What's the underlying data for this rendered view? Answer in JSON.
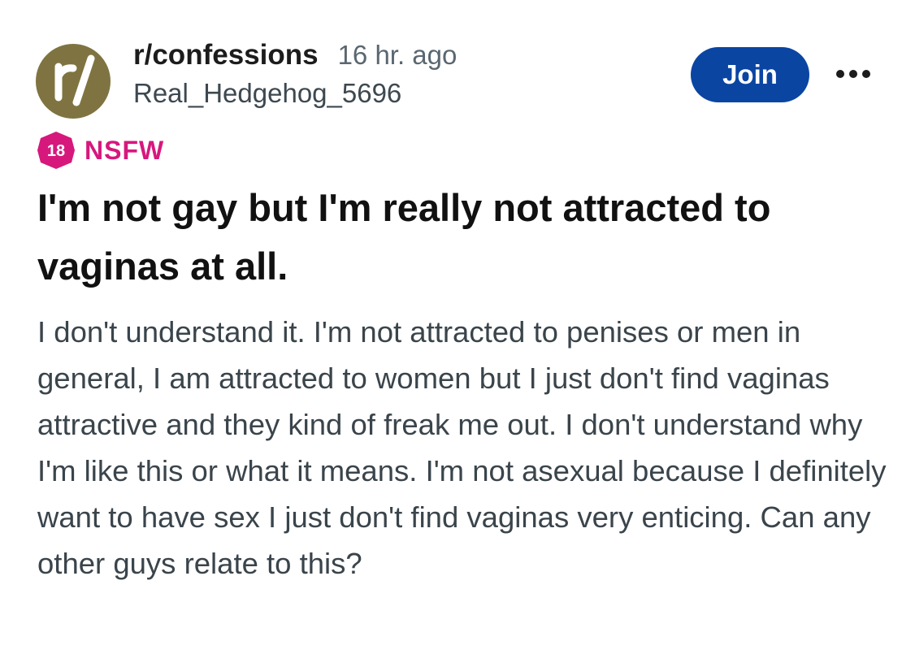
{
  "post": {
    "subreddit": "r/confessions",
    "time_ago": "16 hr. ago",
    "author": "Real_Hedgehog_5696",
    "join_label": "Join",
    "nsfw_badge": "18",
    "nsfw_label": "NSFW",
    "title": "I'm not gay but I'm really not attracted to vaginas at all.",
    "body": "I don't understand it. I'm not attracted to penises or men in general, I am attracted to women but I just don't find vaginas attractive and they kind of freak me out. I don't understand why I'm like this or what it means. I'm not asexual because I definitely want to have sex I just don't find vaginas very enticing. Can any other guys relate to this?"
  },
  "icons": {
    "avatar": "subreddit-avatar-icon",
    "more": "more-options-icon",
    "nsfw": "nsfw-18-icon"
  },
  "colors": {
    "avatar_bg": "#7f7441",
    "join_bg": "#0a45a2",
    "nsfw": "#d6187d"
  }
}
